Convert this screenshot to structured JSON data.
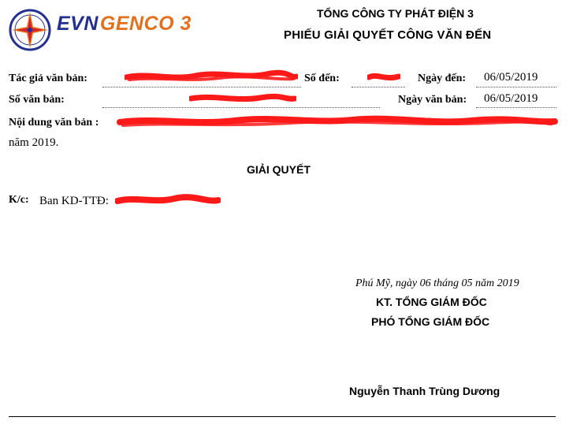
{
  "header": {
    "logo": {
      "brand_part1": "EVN",
      "brand_part2": "GENCO 3",
      "colors": {
        "blue": "#23308f",
        "orange": "#e2701d",
        "red": "#d4202a"
      }
    },
    "company_name": "TỔNG CÔNG TY PHÁT ĐIỆN 3",
    "form_title": "PHIẾU GIẢI QUYẾT CÔNG VĂN ĐẾN"
  },
  "fields": {
    "author": {
      "label": "Tác giả văn bản:"
    },
    "incoming_no": {
      "label": "Số đến:"
    },
    "incoming_date": {
      "label": "Ngày đến:",
      "value": "06/05/2019"
    },
    "doc_no": {
      "label": "Số văn bản:"
    },
    "doc_date": {
      "label": "Ngày văn bản:",
      "value": "06/05/2019"
    },
    "content": {
      "label": "Nội dung văn bản :",
      "line2": "năm 2019."
    }
  },
  "resolution": {
    "heading": "GIẢI QUYẾT",
    "kc_label": "K/c:",
    "kc_value": "Ban KD-TTĐ:"
  },
  "signature": {
    "place_date": "Phú Mỹ, ngày 06 tháng 05 năm 2019",
    "line1": "KT. TỔNG GIÁM ĐỐC",
    "line2": "PHÓ TỔNG GIÁM ĐỐC",
    "name": "Nguyễn Thanh Trùng Dương"
  },
  "redaction_color": "#ff1a1a"
}
